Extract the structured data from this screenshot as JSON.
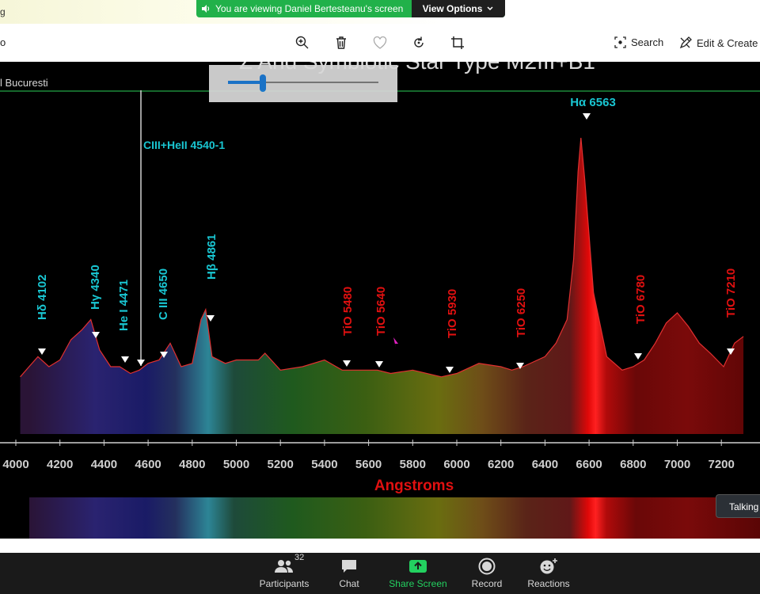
{
  "top_strip": {
    "partial_text": "g",
    "share_banner": "You are viewing Daniel Bertesteanu's screen",
    "view_options": "View Options"
  },
  "toolbar": {
    "left_partial": "o",
    "icons": [
      "zoom-in-icon",
      "delete-icon",
      "favorite-icon",
      "rotate-icon",
      "crop-icon"
    ],
    "search_label": "Search",
    "edit_create_label": "Edit & Create"
  },
  "zoom_slider": {
    "value": 0.23
  },
  "spectrum": {
    "title_partial": "Z And Symbiotic Star Type M2III+B1",
    "observer": "l Bucuresti",
    "x_axis_label": "Angstroms",
    "x_ticks": [
      "4000",
      "4200",
      "4400",
      "4600",
      "4800",
      "5000",
      "5200",
      "5400",
      "5600",
      "5800",
      "6000",
      "6200",
      "6400",
      "6600",
      "6800",
      "7000",
      "7200",
      "7"
    ],
    "marker_line_label": "CIII+HeII 4540-1",
    "peak_label": "Hα 6563",
    "lines_cyan": [
      "Hδ 4102",
      "Hγ 4340",
      "He I 4471",
      "C III 4650",
      "Hβ 4861"
    ],
    "lines_red": [
      "TiO 5480",
      "TiO 5640",
      "TiO 5930",
      "TiO 6250",
      "TiO 6780",
      "TiO 7210"
    ]
  },
  "chart_data": {
    "type": "line",
    "title": "Z And Symbiotic Star Type M2III+B1",
    "xlabel": "Angstroms",
    "ylabel": "",
    "xlim": [
      4000,
      7300
    ],
    "x": [
      4020,
      4060,
      4100,
      4150,
      4200,
      4250,
      4300,
      4340,
      4380,
      4430,
      4471,
      4520,
      4560,
      4600,
      4650,
      4700,
      4750,
      4800,
      4840,
      4861,
      4890,
      4950,
      5000,
      5100,
      5130,
      5200,
      5300,
      5400,
      5480,
      5550,
      5640,
      5700,
      5800,
      5930,
      6000,
      6100,
      6200,
      6250,
      6300,
      6400,
      6450,
      6500,
      6530,
      6550,
      6563,
      6580,
      6620,
      6680,
      6750,
      6800,
      6850,
      6900,
      6950,
      7000,
      7050,
      7100,
      7150,
      7210,
      7260,
      7300
    ],
    "y": [
      0.17,
      0.2,
      0.23,
      0.2,
      0.22,
      0.28,
      0.31,
      0.34,
      0.25,
      0.2,
      0.2,
      0.18,
      0.19,
      0.21,
      0.22,
      0.27,
      0.2,
      0.21,
      0.34,
      0.37,
      0.23,
      0.21,
      0.22,
      0.22,
      0.24,
      0.19,
      0.2,
      0.22,
      0.19,
      0.19,
      0.19,
      0.18,
      0.19,
      0.17,
      0.18,
      0.21,
      0.2,
      0.19,
      0.2,
      0.23,
      0.27,
      0.34,
      0.52,
      0.78,
      0.88,
      0.76,
      0.42,
      0.23,
      0.19,
      0.2,
      0.22,
      0.27,
      0.33,
      0.36,
      0.32,
      0.27,
      0.24,
      0.2,
      0.27,
      0.29
    ]
  },
  "bottom_bar": {
    "participants_count": "32",
    "participants": "Participants",
    "chat": "Chat",
    "share_screen": "Share Screen",
    "record": "Record",
    "reactions": "Reactions",
    "talking": "Talking"
  }
}
